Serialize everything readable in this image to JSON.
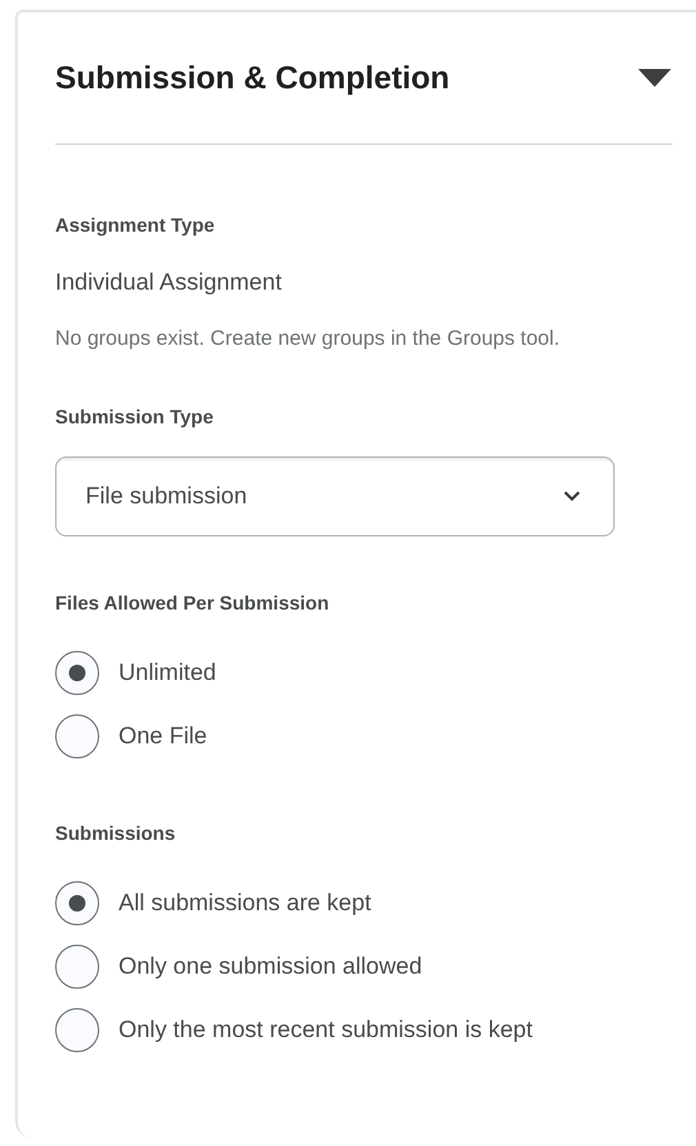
{
  "panel": {
    "title": "Submission & Completion",
    "expanded": true
  },
  "assignment_type": {
    "label": "Assignment Type",
    "value": "Individual Assignment",
    "note": "No groups exist. Create new groups in the Groups tool."
  },
  "submission_type": {
    "label": "Submission Type",
    "value": "File submission"
  },
  "radio_groups": [
    {
      "label": "Files Allowed Per Submission",
      "options": [
        {
          "label": "Unlimited",
          "selected": true
        },
        {
          "label": "One File",
          "selected": false
        }
      ]
    },
    {
      "label": "Submissions",
      "options": [
        {
          "label": "All submissions are kept",
          "selected": true
        },
        {
          "label": "Only one submission allowed",
          "selected": false
        },
        {
          "label": "Only the most recent submission is kept",
          "selected": false
        }
      ]
    }
  ]
}
